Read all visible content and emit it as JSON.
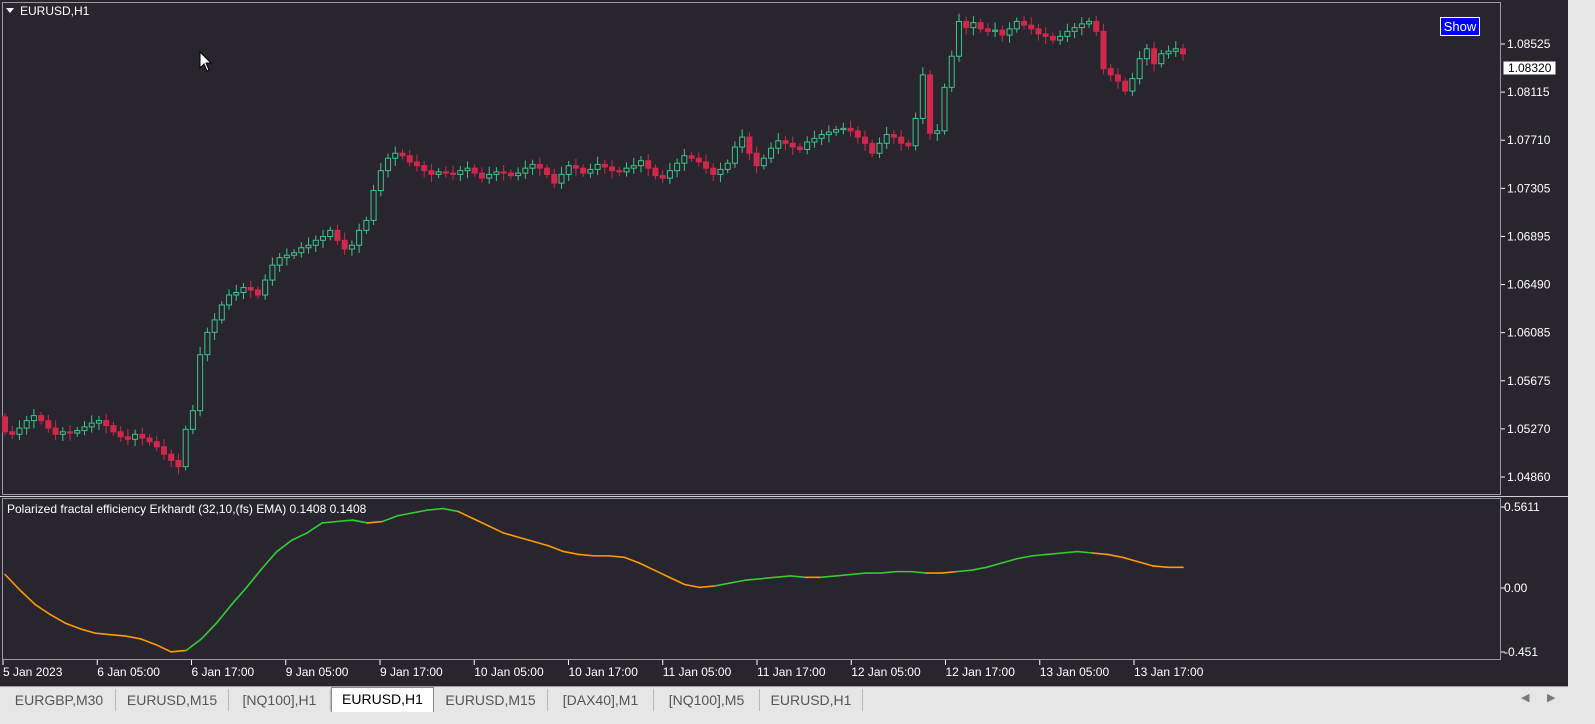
{
  "window": {
    "symbol_title": "EURUSD,H1"
  },
  "show_button": {
    "label": "Show"
  },
  "price_axis": {
    "ticks": [
      "1.08525",
      "1.08115",
      "1.07710",
      "1.07305",
      "1.06895",
      "1.06490",
      "1.06085",
      "1.05675",
      "1.05270",
      "1.04860"
    ],
    "current_price": "1.08320"
  },
  "indicator": {
    "label": "Polarized fractal efficiency Erkhardt (32,10,(fs) EMA) 0.1408 0.1408",
    "ticks": [
      "0.5611",
      "0.00",
      "-0.451"
    ]
  },
  "time_axis": {
    "labels": [
      "5 Jan 2023",
      "6 Jan 05:00",
      "6 Jan 17:00",
      "9 Jan 05:00",
      "9 Jan 17:00",
      "10 Jan 05:00",
      "10 Jan 17:00",
      "11 Jan 05:00",
      "11 Jan 17:00",
      "12 Jan 05:00",
      "12 Jan 17:00",
      "13 Jan 05:00",
      "13 Jan 17:00"
    ]
  },
  "tabs": [
    "EURGBP,M30",
    "EURUSD,M15",
    "[NQ100],H1",
    "EURUSD,H1",
    "EURUSD,M15",
    "[DAX40],M1",
    "[NQ100],M5",
    "EURUSD,H1"
  ],
  "active_tab": 3,
  "colors": {
    "background": "#29252f",
    "bull": "#3cc48a",
    "bear": "#d0284a",
    "pfe_up": "#33cc33",
    "pfe_down": "#ff9900",
    "axis_text": "#ffffff"
  },
  "chart_data": [
    {
      "type": "candlestick",
      "title": "EURUSD,H1",
      "ylim": [
        1.0478,
        1.0872
      ],
      "x_start": "5 Jan 2023",
      "timeframe": "H1",
      "close": [
        1.0528,
        1.0526,
        1.0531,
        1.0537,
        1.0541,
        1.0537,
        1.0531,
        1.0526,
        1.0528,
        1.0527,
        1.0529,
        1.0532,
        1.0535,
        1.0537,
        1.0533,
        1.0528,
        1.0524,
        1.0522,
        1.0526,
        1.0523,
        1.052,
        1.0516,
        1.051,
        1.0505,
        1.05,
        1.053,
        1.0545,
        1.059,
        1.0608,
        1.0618,
        1.063,
        1.0638,
        1.064,
        1.0644,
        1.0642,
        1.0638,
        1.065,
        1.0662,
        1.0668,
        1.067,
        1.0672,
        1.0676,
        1.0678,
        1.0682,
        1.0685,
        1.069,
        1.0682,
        1.0675,
        1.0678,
        1.069,
        1.0698,
        1.0722,
        1.0738,
        1.0748,
        1.0752,
        1.075,
        1.0745,
        1.0742,
        1.0738,
        1.0735,
        1.0737,
        1.0736,
        1.0735,
        1.0738,
        1.074,
        1.0736,
        1.0732,
        1.0735,
        1.0737,
        1.0736,
        1.0734,
        1.0736,
        1.074,
        1.0743,
        1.074,
        1.0735,
        1.0728,
        1.0735,
        1.0742,
        1.074,
        1.0736,
        1.0739,
        1.0743,
        1.0741,
        1.0738,
        1.0737,
        1.074,
        1.0742,
        1.0746,
        1.074,
        1.0734,
        1.0732,
        1.0738,
        1.0744,
        1.075,
        1.0748,
        1.0745,
        1.074,
        1.0735,
        1.0739,
        1.0744,
        1.0757,
        1.0765,
        1.0752,
        1.0742,
        1.0748,
        1.0756,
        1.0762,
        1.076,
        1.0757,
        1.0755,
        1.0761,
        1.0764,
        1.0767,
        1.0769,
        1.0771,
        1.0772,
        1.077,
        1.0765,
        1.076,
        1.0752,
        1.076,
        1.0767,
        1.0765,
        1.076,
        1.0758,
        1.078,
        1.0815,
        1.0768,
        1.077,
        1.0805,
        1.083,
        1.0858,
        1.0853,
        1.0857,
        1.0852,
        1.085,
        1.0851,
        1.0847,
        1.0852,
        1.0858,
        1.0855,
        1.0852,
        1.0848,
        1.0846,
        1.0843,
        1.0846,
        1.085,
        1.0853,
        1.0856,
        1.0858,
        1.085,
        1.082,
        1.0815,
        1.081,
        1.0802,
        1.0812,
        1.0828,
        1.0836,
        1.0824,
        1.0832,
        1.0834,
        1.0836,
        1.0832
      ]
    },
    {
      "type": "line",
      "title": "Polarized fractal efficiency Erkhardt (32,10,(fs) EMA) 0.1408 0.1408",
      "ylim": [
        -0.451,
        0.5611
      ],
      "values": [
        0.09,
        -0.02,
        -0.12,
        -0.19,
        -0.25,
        -0.29,
        -0.32,
        -0.33,
        -0.34,
        -0.36,
        -0.4,
        -0.45,
        -0.44,
        -0.36,
        -0.25,
        -0.12,
        0.0,
        0.13,
        0.25,
        0.33,
        0.38,
        0.45,
        0.46,
        0.47,
        0.45,
        0.46,
        0.5,
        0.52,
        0.54,
        0.55,
        0.53,
        0.48,
        0.43,
        0.38,
        0.35,
        0.32,
        0.29,
        0.25,
        0.23,
        0.22,
        0.22,
        0.21,
        0.17,
        0.12,
        0.07,
        0.02,
        0.0,
        0.01,
        0.03,
        0.05,
        0.06,
        0.07,
        0.08,
        0.07,
        0.07,
        0.08,
        0.09,
        0.1,
        0.1,
        0.11,
        0.11,
        0.1,
        0.1,
        0.11,
        0.12,
        0.14,
        0.17,
        0.2,
        0.22,
        0.23,
        0.24,
        0.25,
        0.24,
        0.23,
        0.21,
        0.18,
        0.15,
        0.14,
        0.14
      ],
      "direction": [
        "down",
        "down",
        "down",
        "down",
        "down",
        "down",
        "down",
        "down",
        "down",
        "down",
        "down",
        "down",
        "up",
        "up",
        "up",
        "up",
        "up",
        "up",
        "up",
        "up",
        "up",
        "up",
        "up",
        "up",
        "down",
        "up",
        "up",
        "up",
        "up",
        "up",
        "down",
        "down",
        "down",
        "down",
        "down",
        "down",
        "down",
        "down",
        "down",
        "down",
        "down",
        "down",
        "down",
        "down",
        "down",
        "down",
        "down",
        "up",
        "up",
        "up",
        "up",
        "up",
        "up",
        "down",
        "up",
        "up",
        "up",
        "up",
        "up",
        "up",
        "up",
        "down",
        "down",
        "up",
        "up",
        "up",
        "up",
        "up",
        "up",
        "up",
        "up",
        "up",
        "down",
        "down",
        "down",
        "down",
        "down",
        "down",
        "down"
      ]
    }
  ]
}
